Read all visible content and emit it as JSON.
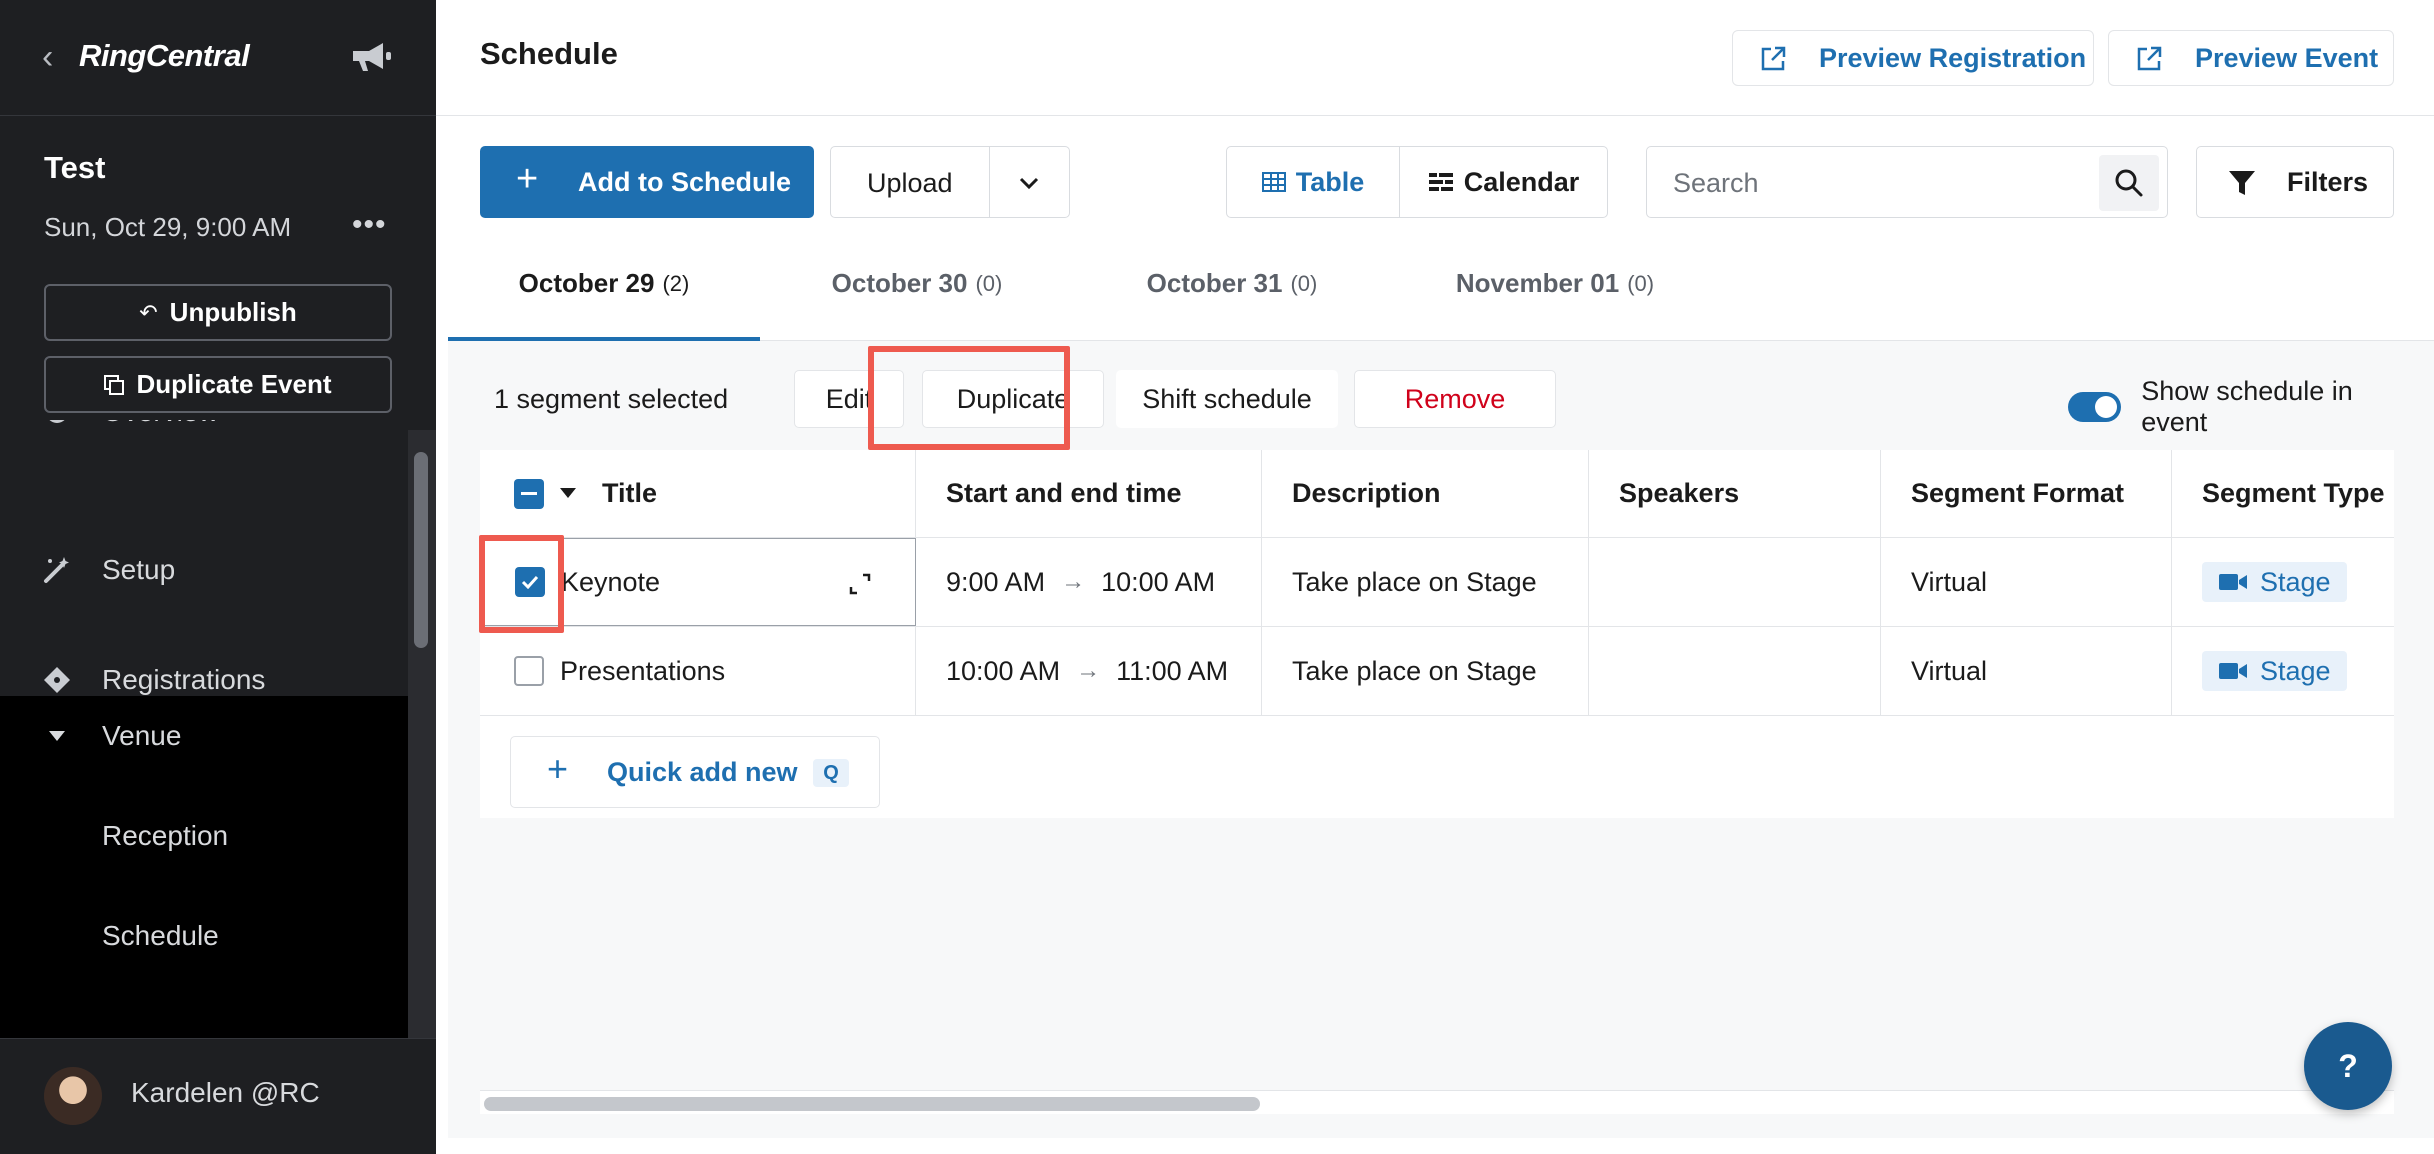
{
  "sidebar": {
    "brand": "RingCentral",
    "event": {
      "title": "Test",
      "date": "Sun, Oct 29, 9:00 AM",
      "more": "•••"
    },
    "unpublish_label": "Unpublish",
    "duplicate_event_label": "Duplicate Event",
    "nav": {
      "overview": "Overview",
      "setup": "Setup",
      "registrations": "Registrations",
      "venue": "Venue",
      "reception": "Reception",
      "schedule": "Schedule"
    },
    "user": {
      "name": "Kardelen @RC"
    }
  },
  "header": {
    "title": "Schedule",
    "preview_registration": "Preview Registration",
    "preview_event": "Preview Event"
  },
  "toolbar": {
    "add_label": "Add to Schedule",
    "upload_label": "Upload",
    "view_table": "Table",
    "view_calendar": "Calendar",
    "search_placeholder": "Search",
    "filters_label": "Filters"
  },
  "tabs": [
    {
      "label": "October 29",
      "count": "(2)",
      "active": true
    },
    {
      "label": "October 30",
      "count": "(0)"
    },
    {
      "label": "October 31",
      "count": "(0)"
    },
    {
      "label": "November 01",
      "count": "(0)"
    }
  ],
  "selection": {
    "text": "1 segment selected",
    "edit": "Edit",
    "duplicate": "Duplicate",
    "shift": "Shift schedule",
    "remove": "Remove",
    "toggle_label": "Show schedule in event",
    "toggle_on": true
  },
  "table": {
    "columns": [
      "Title",
      "Start and end time",
      "Description",
      "Speakers",
      "Segment Format",
      "Segment Type"
    ],
    "rows": [
      {
        "checked": true,
        "title": "Keynote",
        "start": "9:00 AM",
        "end": "10:00 AM",
        "description": "Take place on Stage",
        "speakers": "",
        "format": "Virtual",
        "type": "Stage"
      },
      {
        "checked": false,
        "title": "Presentations",
        "start": "10:00 AM",
        "end": "11:00 AM",
        "description": "Take place on Stage",
        "speakers": "",
        "format": "Virtual",
        "type": "Stage"
      }
    ],
    "arrow": "→",
    "quick_add": "Quick add new",
    "quick_add_key": "Q"
  },
  "help": "?",
  "colors": {
    "accent": "#1e6fb0",
    "danger": "#d0021b",
    "highlight": "#ee5a4f",
    "sidebar_bg": "#1e1f22"
  }
}
